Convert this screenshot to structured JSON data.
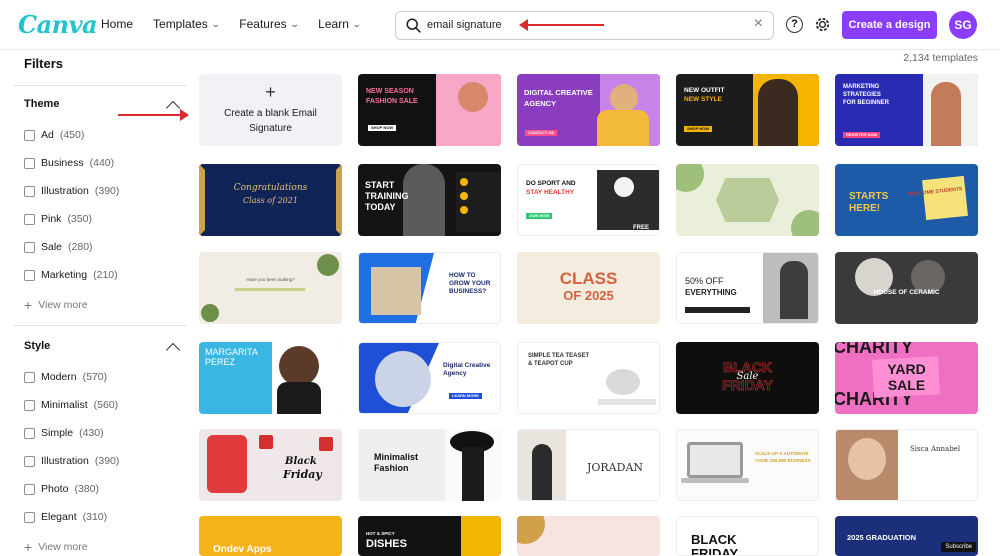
{
  "header": {
    "logo": "Canva",
    "nav": [
      {
        "label": "Home",
        "has_menu": false
      },
      {
        "label": "Templates",
        "has_menu": true
      },
      {
        "label": "Features",
        "has_menu": true
      },
      {
        "label": "Learn",
        "has_menu": true
      }
    ],
    "search": {
      "value": "email signature",
      "icon": "search-icon"
    },
    "create_button": "Create a design",
    "avatar_initials": "SG",
    "icons": [
      "help-icon",
      "settings-gear-icon",
      "clear-search-icon"
    ]
  },
  "colors": {
    "brand_purple": "#8b3dff",
    "logo_teal": "#20c4cb",
    "annotation_arrow": "#d92b2b"
  },
  "sidebar": {
    "title": "Filters",
    "groups": [
      {
        "title": "Theme",
        "options": [
          {
            "label": "Ad",
            "count": "(450)"
          },
          {
            "label": "Business",
            "count": "(440)"
          },
          {
            "label": "Illustration",
            "count": "(390)"
          },
          {
            "label": "Pink",
            "count": "(350)"
          },
          {
            "label": "Sale",
            "count": "(280)"
          },
          {
            "label": "Marketing",
            "count": "(210)"
          }
        ],
        "more": "View more"
      },
      {
        "title": "Style",
        "options": [
          {
            "label": "Modern",
            "count": "(570)"
          },
          {
            "label": "Minimalist",
            "count": "(560)"
          },
          {
            "label": "Simple",
            "count": "(430)"
          },
          {
            "label": "Illustration",
            "count": "(390)"
          },
          {
            "label": "Photo",
            "count": "(380)"
          },
          {
            "label": "Elegant",
            "count": "(310)"
          }
        ],
        "more": "View more"
      }
    ]
  },
  "results": {
    "count": "2,134 templates",
    "blank_tile": "Create a blank Email Signature",
    "tiles": [
      {
        "texts": [
          "NEW SEASON",
          "FASHION SALE",
          "SHOP NOW"
        ]
      },
      {
        "texts": [
          "DIGITAL CREATIVE",
          "AGENCY",
          "CONTACT US"
        ]
      },
      {
        "texts": [
          "NEW OUTFIT",
          "NEW STYLE",
          "SHOP NOW"
        ]
      },
      {
        "texts": [
          "MARKETING",
          "STRATEGIES",
          "FOR BEGINNER",
          "REGISTER NOW"
        ]
      },
      {
        "texts": [
          "Congratulations",
          "Class of 2021"
        ]
      },
      {
        "texts": [
          "START",
          "TRAINING",
          "TODAY"
        ]
      },
      {
        "texts": [
          "DO SPORT AND",
          "STAY HEALTHY",
          "JOIN NOW",
          "FREE"
        ]
      },
      {
        "texts": []
      },
      {
        "texts": [
          "STARTS",
          "HERE!",
          "WELCOME STUDENTS"
        ]
      },
      {
        "texts": [
          "Have you been looking?"
        ]
      },
      {
        "texts": [
          "HOW TO",
          "GROW YOUR",
          "BUSINESS?"
        ]
      },
      {
        "texts": [
          "CLASS",
          "OF 2025"
        ]
      },
      {
        "texts": [
          "50% OFF",
          "EVERYTHING"
        ]
      },
      {
        "texts": [
          "HOUSE OF CERAMIC"
        ]
      },
      {
        "texts": [
          "MARGARITA",
          "PEREZ"
        ]
      },
      {
        "texts": [
          "Digital Creative",
          "Agency",
          "LEARN MORE"
        ]
      },
      {
        "texts": [
          "SIMPLE TEA TEASET",
          "& TEAPOT CUP"
        ]
      },
      {
        "texts": [
          "BLACK",
          "FRIDAY",
          "Sale"
        ]
      },
      {
        "texts": [
          "CHARITY",
          "YARD",
          "SALE"
        ]
      },
      {
        "texts": [
          "Black",
          "Friday"
        ]
      },
      {
        "texts": [
          "Minimalist",
          "Fashion"
        ]
      },
      {
        "texts": [
          "JORADAN"
        ]
      },
      {
        "texts": [
          "SCALE-UP & AUTOMATE",
          "YOUR ONLINE BUSINESS"
        ]
      },
      {
        "texts": [
          "Sisca Annabel"
        ]
      },
      {
        "texts": [
          "Ondev Apps"
        ]
      },
      {
        "texts": [
          "HOT & SPICY",
          "DISHES"
        ]
      },
      {
        "texts": []
      },
      {
        "texts": [
          "BLACK",
          "FRIDAY"
        ]
      },
      {
        "texts": [
          "2025 GRADUATION"
        ]
      }
    ],
    "subscribe_badge": "Subscribe"
  }
}
